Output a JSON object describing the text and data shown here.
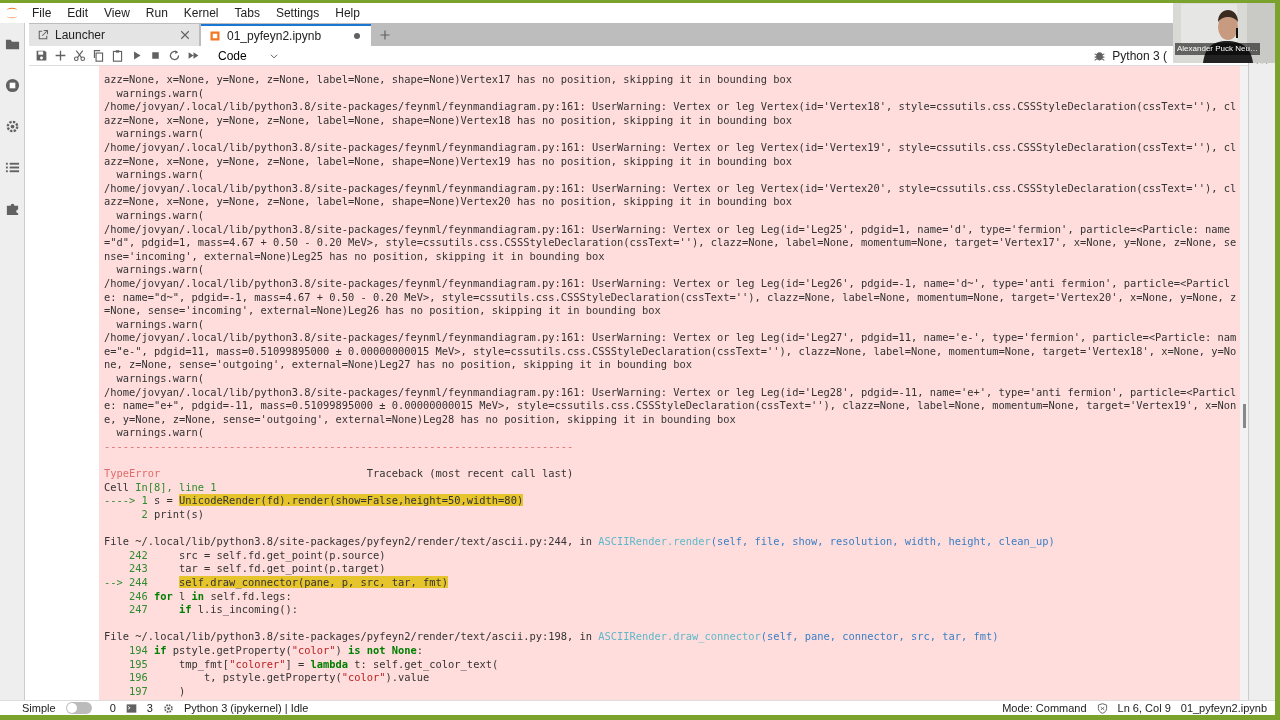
{
  "menu": [
    "File",
    "Edit",
    "View",
    "Run",
    "Kernel",
    "Tabs",
    "Settings",
    "Help"
  ],
  "tabs": [
    {
      "label": "Launcher",
      "kind": "launcher",
      "selected": false,
      "dirty": false
    },
    {
      "label": "01_pyfeyn2.ipynb",
      "kind": "notebook",
      "selected": true,
      "dirty": true
    }
  ],
  "toolbar": {
    "cell_type": "Code",
    "kernel": "Python 3 ("
  },
  "output": {
    "warnings": [
      "azz=None, x=None, y=None, z=None, label=None, shape=None)Vertex17 has no position, skipping it in bounding box",
      "  warnings.warn(",
      "/home/jovyan/.local/lib/python3.8/site-packages/feynml/feynmandiagram.py:161: UserWarning: Vertex or leg Vertex(id='Vertex18', style=cssutils.css.CSSStyleDeclaration(cssText=''), cl",
      "azz=None, x=None, y=None, z=None, label=None, shape=None)Vertex18 has no position, skipping it in bounding box",
      "  warnings.warn(",
      "/home/jovyan/.local/lib/python3.8/site-packages/feynml/feynmandiagram.py:161: UserWarning: Vertex or leg Vertex(id='Vertex19', style=cssutils.css.CSSStyleDeclaration(cssText=''), cl",
      "azz=None, x=None, y=None, z=None, label=None, shape=None)Vertex19 has no position, skipping it in bounding box",
      "  warnings.warn(",
      "/home/jovyan/.local/lib/python3.8/site-packages/feynml/feynmandiagram.py:161: UserWarning: Vertex or leg Vertex(id='Vertex20', style=cssutils.css.CSSStyleDeclaration(cssText=''), cl",
      "azz=None, x=None, y=None, z=None, label=None, shape=None)Vertex20 has no position, skipping it in bounding box",
      "  warnings.warn(",
      "/home/jovyan/.local/lib/python3.8/site-packages/feynml/feynmandiagram.py:161: UserWarning: Vertex or leg Leg(id='Leg25', pdgid=1, name='d', type='fermion', particle=<Particle: name",
      "=\"d\", pdgid=1, mass=4.67 + 0.50 - 0.20 MeV>, style=cssutils.css.CSSStyleDeclaration(cssText=''), clazz=None, label=None, momentum=None, target='Vertex17', x=None, y=None, z=None, se",
      "nse='incoming', external=None)Leg25 has no position, skipping it in bounding box",
      "  warnings.warn(",
      "/home/jovyan/.local/lib/python3.8/site-packages/feynml/feynmandiagram.py:161: UserWarning: Vertex or leg Leg(id='Leg26', pdgid=-1, name='d~', type='anti fermion', particle=<Particl",
      "e: name=\"d~\", pdgid=-1, mass=4.67 + 0.50 - 0.20 MeV>, style=cssutils.css.CSSStyleDeclaration(cssText=''), clazz=None, label=None, momentum=None, target='Vertex20', x=None, y=None, z",
      "=None, sense='incoming', external=None)Leg26 has no position, skipping it in bounding box",
      "  warnings.warn(",
      "/home/jovyan/.local/lib/python3.8/site-packages/feynml/feynmandiagram.py:161: UserWarning: Vertex or leg Leg(id='Leg27', pdgid=11, name='e-', type='fermion', particle=<Particle: nam",
      "e=\"e-\", pdgid=11, mass=0.51099895000 ± 0.00000000015 MeV>, style=cssutils.css.CSSStyleDeclaration(cssText=''), clazz=None, label=None, momentum=None, target='Vertex18', x=None, y=No",
      "ne, z=None, sense='outgoing', external=None)Leg27 has no position, skipping it in bounding box",
      "  warnings.warn(",
      "/home/jovyan/.local/lib/python3.8/site-packages/feynml/feynmandiagram.py:161: UserWarning: Vertex or leg Leg(id='Leg28', pdgid=-11, name='e+', type='anti fermion', particle=<Particl",
      "e: name=\"e+\", pdgid=-11, mass=0.51099895000 ± 0.00000000015 MeV>, style=cssutils.css.CSSStyleDeclaration(cssText=''), clazz=None, label=None, momentum=None, target='Vertex19', x=Non",
      "e, y=None, z=None, sense='outgoing', external=None)Leg28 has no position, skipping it in bounding box",
      "  warnings.warn("
    ],
    "traceback": [
      {
        "gap_before": false,
        "segments": [
          {
            "kind": "red",
            "text": "---------------------------------------------------------------------------"
          }
        ]
      },
      {
        "gap_before": true,
        "segments": [
          {
            "kind": "red",
            "text": "TypeError"
          },
          {
            "kind": "plain",
            "text": "                                 Traceback (most recent call last)"
          }
        ]
      },
      {
        "gap_before": false,
        "segments": [
          {
            "kind": "plain",
            "text": "Cell "
          },
          {
            "kind": "green",
            "text": "In[8], line 1"
          }
        ]
      },
      {
        "gap_before": false,
        "segments": [
          {
            "kind": "green",
            "text": "----> 1 "
          },
          {
            "kind": "plain",
            "text": "s = "
          },
          {
            "kind": "highlight",
            "text": "UnicodeRender(fd).render(show=False,height=50,width=80)"
          }
        ]
      },
      {
        "gap_before": false,
        "segments": [
          {
            "kind": "green",
            "text": "      2 "
          },
          {
            "kind": "plain",
            "text": "print(s)"
          }
        ]
      },
      {
        "gap_before": true,
        "segments": [
          {
            "kind": "plain",
            "text": "File ~/.local/lib/python3.8/site-packages/pyfeyn2/render/text/ascii.py:244, in "
          },
          {
            "kind": "cyan",
            "text": "ASCIIRender.render"
          },
          {
            "kind": "blue",
            "text": "(self, file, show, resolution, width, height, clean_up)"
          }
        ]
      },
      {
        "gap_before": false,
        "segments": [
          {
            "kind": "green",
            "text": "    242 "
          },
          {
            "kind": "plain",
            "text": "    src = self.fd.get_point(p.source)"
          }
        ]
      },
      {
        "gap_before": false,
        "segments": [
          {
            "kind": "green",
            "text": "    243 "
          },
          {
            "kind": "plain",
            "text": "    tar = self.fd.get_point(p.target)"
          }
        ]
      },
      {
        "gap_before": false,
        "segments": [
          {
            "kind": "green",
            "text": "--> 244     "
          },
          {
            "kind": "highlight",
            "text": "self.draw_connector(pane, p, src, tar, fmt)"
          }
        ]
      },
      {
        "gap_before": false,
        "segments": [
          {
            "kind": "green",
            "text": "    246 "
          },
          {
            "kind": "keyword",
            "text": "for"
          },
          {
            "kind": "plain",
            "text": " l "
          },
          {
            "kind": "keyword",
            "text": "in"
          },
          {
            "kind": "plain",
            "text": " self.fd.legs:"
          }
        ]
      },
      {
        "gap_before": false,
        "segments": [
          {
            "kind": "green",
            "text": "    247     "
          },
          {
            "kind": "keyword",
            "text": "if"
          },
          {
            "kind": "plain",
            "text": " l.is_incoming():"
          }
        ]
      },
      {
        "gap_before": true,
        "segments": [
          {
            "kind": "plain",
            "text": "File ~/.local/lib/python3.8/site-packages/pyfeyn2/render/text/ascii.py:198, in "
          },
          {
            "kind": "cyan",
            "text": "ASCIIRender.draw_connector"
          },
          {
            "kind": "blue",
            "text": "(self, pane, connector, src, tar, fmt)"
          }
        ]
      },
      {
        "gap_before": false,
        "segments": [
          {
            "kind": "green",
            "text": "    194 "
          },
          {
            "kind": "keyword",
            "text": "if"
          },
          {
            "kind": "plain",
            "text": " pstyle.getProperty("
          },
          {
            "kind": "string",
            "text": "\"color\""
          },
          {
            "kind": "plain",
            "text": ") "
          },
          {
            "kind": "keyword",
            "text": "is not None"
          },
          {
            "kind": "plain",
            "text": ":"
          }
        ]
      },
      {
        "gap_before": false,
        "segments": [
          {
            "kind": "green",
            "text": "    195 "
          },
          {
            "kind": "plain",
            "text": "    tmp_fmt["
          },
          {
            "kind": "string",
            "text": "\"colorer\""
          },
          {
            "kind": "plain",
            "text": "] = "
          },
          {
            "kind": "keyword",
            "text": "lambda"
          },
          {
            "kind": "plain",
            "text": " t: self.get_color_text("
          }
        ]
      },
      {
        "gap_before": false,
        "segments": [
          {
            "kind": "green",
            "text": "    196 "
          },
          {
            "kind": "plain",
            "text": "        t, pstyle.getProperty("
          },
          {
            "kind": "string",
            "text": "\"color\""
          },
          {
            "kind": "plain",
            "text": ").value"
          }
        ]
      },
      {
        "gap_before": false,
        "segments": [
          {
            "kind": "green",
            "text": "    197 "
          },
          {
            "kind": "plain",
            "text": "    )"
          }
        ]
      }
    ]
  },
  "webcam": {
    "name": "Alexander Puck Neu…"
  },
  "status_bar": {
    "simple_label": "Simple",
    "simple_mode": false,
    "terminals": "0",
    "kernels": "3",
    "kernel_status": "Python 3 (ipykernel) | Idle",
    "mode": "Mode: Command",
    "cursor": "Ln 6, Col 9",
    "file": "01_pyfeyn2.ipynb"
  }
}
